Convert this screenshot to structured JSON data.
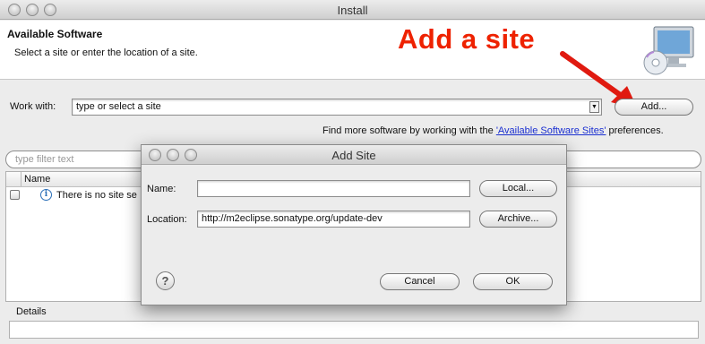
{
  "window": {
    "title": "Install",
    "header_title": "Available Software",
    "header_subtitle": "Select a site or enter the location of a site."
  },
  "annotation": {
    "text": "Add a site",
    "color": "#ee2200"
  },
  "work_with": {
    "label": "Work with:",
    "value": "type or select a site",
    "add_button": "Add..."
  },
  "more_software": {
    "prefix": "Find more software by working with the ",
    "link": "'Available Software Sites'",
    "suffix": " preferences."
  },
  "filter": {
    "placeholder": "type filter text"
  },
  "table": {
    "columns": [
      "Name"
    ],
    "rows": [
      {
        "text": "There is no site se"
      }
    ]
  },
  "details": {
    "label": "Details"
  },
  "dialog": {
    "title": "Add Site",
    "name_label": "Name:",
    "name_value": "",
    "location_label": "Location:",
    "location_value": "http://m2eclipse.sonatype.org/update-dev",
    "local_button": "Local...",
    "archive_button": "Archive...",
    "cancel_button": "Cancel",
    "ok_button": "OK",
    "help_icon": "?"
  }
}
